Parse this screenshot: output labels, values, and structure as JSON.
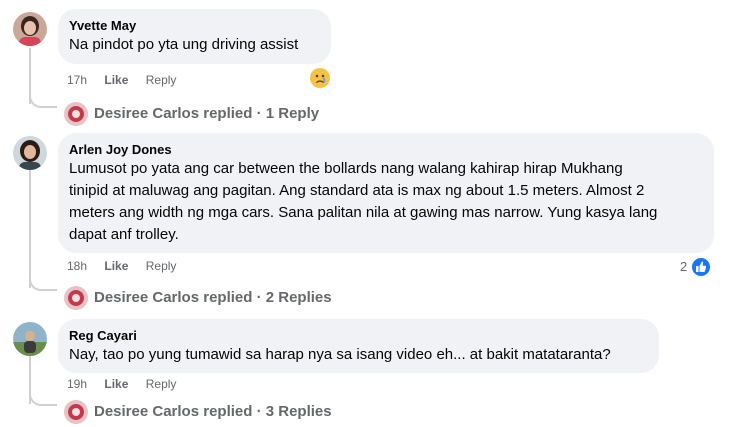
{
  "comments": [
    {
      "author": "Yvette May",
      "lines": [
        "Na pindot po yta ung driving assist"
      ],
      "time": "17h",
      "like": "Like",
      "reply": "Reply",
      "reaction": "sad-emoji",
      "replies": "Desiree Carlos replied · 1 Reply"
    },
    {
      "author": "Arlen Joy Dones",
      "lines": [
        "Lumusot po yata ang car between the bollards nang walang kahirap hirap Mukhang",
        "tinipid at maluwag ang pagitan. Ang standard ata is max ng about 1.5 meters. Almost 2",
        "meters ang width ng mga cars. Sana palitan nila at gawing mas narrow. Yung kasya lang",
        "dapat anf trolley."
      ],
      "time": "18h",
      "like": "Like",
      "reply": "Reply",
      "reaction_count": "2",
      "reaction": "like-icon",
      "replies": "Desiree Carlos replied · 2 Replies"
    },
    {
      "author": "Reg Cayari",
      "lines": [
        "Nay, tao po yung tumawid sa harap nya sa isang video eh... at bakit matataranta?"
      ],
      "time": "19h",
      "like": "Like",
      "reply": "Reply",
      "replies": "Desiree Carlos replied · 3 Replies"
    }
  ],
  "colors": {
    "bubble": "#f0f2f5",
    "meta": "#65676b",
    "like_blue": "#1877f2",
    "thread": "#ced0d4"
  }
}
